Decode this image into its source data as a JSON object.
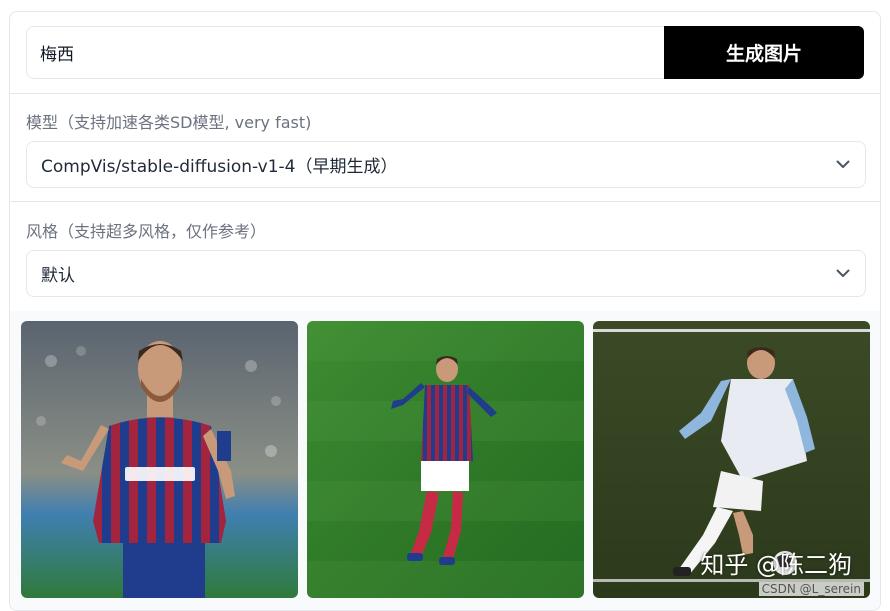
{
  "prompt": {
    "value": "梅西",
    "button_label": "生成图片"
  },
  "model": {
    "label": "模型（支持加速各类SD模型, very fast)",
    "selected": "CompVis/stable-diffusion-v1-4（早期生成）"
  },
  "style": {
    "label": "风格（支持超多风格，仅作参考）",
    "selected": "默认"
  },
  "watermark": {
    "zhihu": "知乎 @陈二狗",
    "csdn": "CSDN @L_serein"
  },
  "icons": {
    "model_select": "chevron-down-icon",
    "style_select": "chevron-down-icon"
  },
  "colors": {
    "button_bg": "#000000",
    "button_text": "#ffffff",
    "border": "#e5e7eb"
  }
}
